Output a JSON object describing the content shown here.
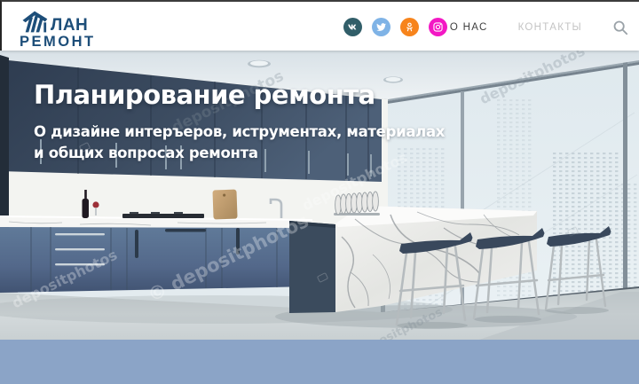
{
  "header": {
    "logo": {
      "line1": "ЛАН",
      "line2": "РЕМОНТ",
      "color": "#1d4e79"
    },
    "social": {
      "vk": {
        "name": "vk",
        "color": "#315e69"
      },
      "twitter": {
        "name": "twitter",
        "color": "#7fb3e6"
      },
      "ok": {
        "name": "odnoklassniki",
        "color": "#f7841c"
      },
      "instagram": {
        "name": "instagram",
        "color": "#f318c4"
      }
    },
    "nav": {
      "about": "О НАС",
      "contacts": "КОНТАКТЫ"
    }
  },
  "hero": {
    "title": "Планирование ремонта",
    "subtitle_line1": "О дизайне интеръеров, иструментах, материалах",
    "subtitle_line2": "и общих вопросах ремонта",
    "watermark": "depositphotos",
    "copyright_symbol": "©"
  },
  "footer": {
    "band_color": "#8ba4c7"
  }
}
